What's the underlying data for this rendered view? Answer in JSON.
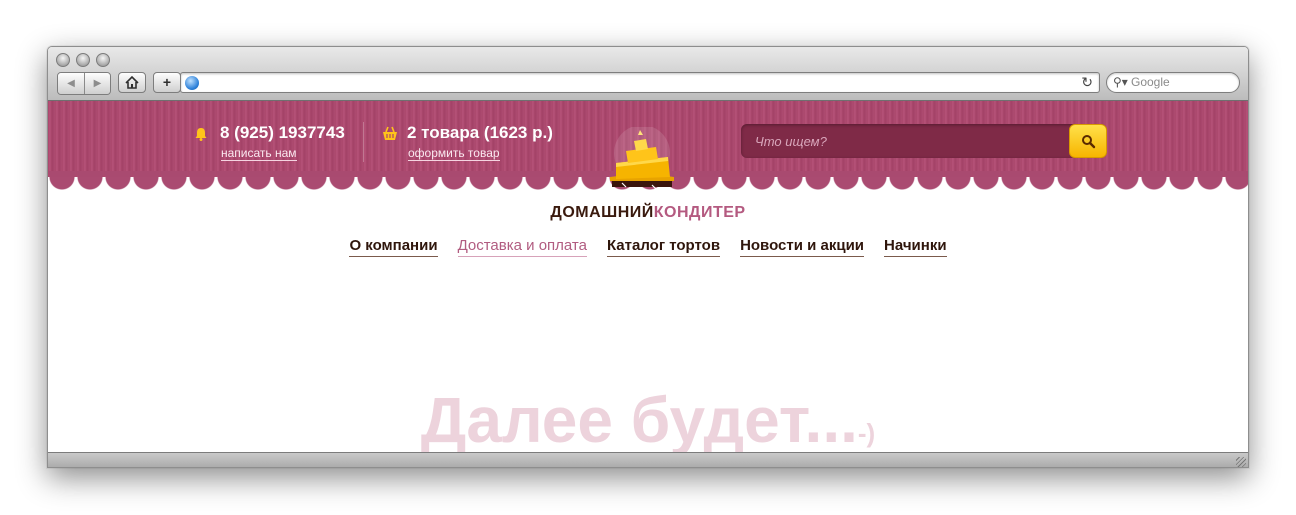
{
  "browser": {
    "search_placeholder": "Google",
    "url": ""
  },
  "header": {
    "phone": "8 (925) 1937743",
    "write_us": "написать нам",
    "cart": "2 товара (1623 р.)",
    "checkout": "оформить товар",
    "search_placeholder": "Что ищем?"
  },
  "brand": {
    "part1": "ДОМАШНИЙ",
    "part2": "КОНДИТЕР"
  },
  "menu": {
    "items": [
      {
        "label": "О компании"
      },
      {
        "label": "Доставка и оплата"
      },
      {
        "label": "Каталог тортов"
      },
      {
        "label": "Новости и акции"
      },
      {
        "label": "Начинки"
      }
    ],
    "active_index": 1
  },
  "content": {
    "placeholder": "Далее будет...",
    "smile": "-)"
  },
  "colors": {
    "header_bg": "#a9466b",
    "brand_dark": "#3a1a0e",
    "brand_accent": "#b45a80",
    "search_button": "#f7b500"
  }
}
